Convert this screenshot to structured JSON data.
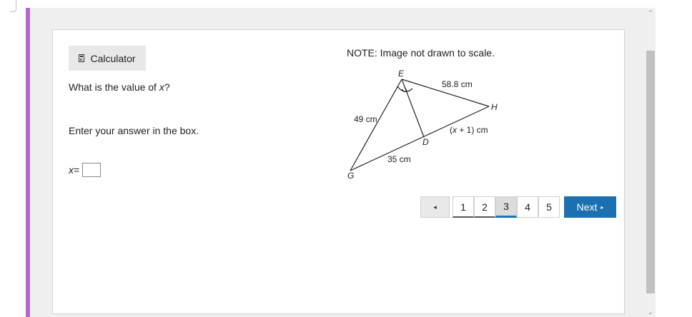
{
  "toolbar": {
    "calculator_label": "Calculator"
  },
  "question": {
    "prompt_pre": "What is the value of ",
    "prompt_var": "x",
    "prompt_post": "?",
    "instruction": "Enter your answer in the box.",
    "answer_var": "x",
    "answer_eq": " =",
    "answer_value": ""
  },
  "figure": {
    "note": "NOTE: Image not drawn to scale.",
    "points": {
      "E": "E",
      "H": "H",
      "D": "D",
      "G": "G"
    },
    "labels": {
      "EH": "58.8 cm",
      "EG": "49 cm",
      "GD": "35 cm",
      "DH_open": "(",
      "DH_var": "x",
      "DH_rest": " + 1) cm"
    }
  },
  "pagination": {
    "prev_symbol": "◂",
    "pages": [
      "1",
      "2",
      "3",
      "4",
      "5"
    ],
    "current_page": "3",
    "next_label": "Next",
    "next_symbol": "▸"
  },
  "scrollbar": {
    "up": "⌃",
    "down": "⌄"
  }
}
